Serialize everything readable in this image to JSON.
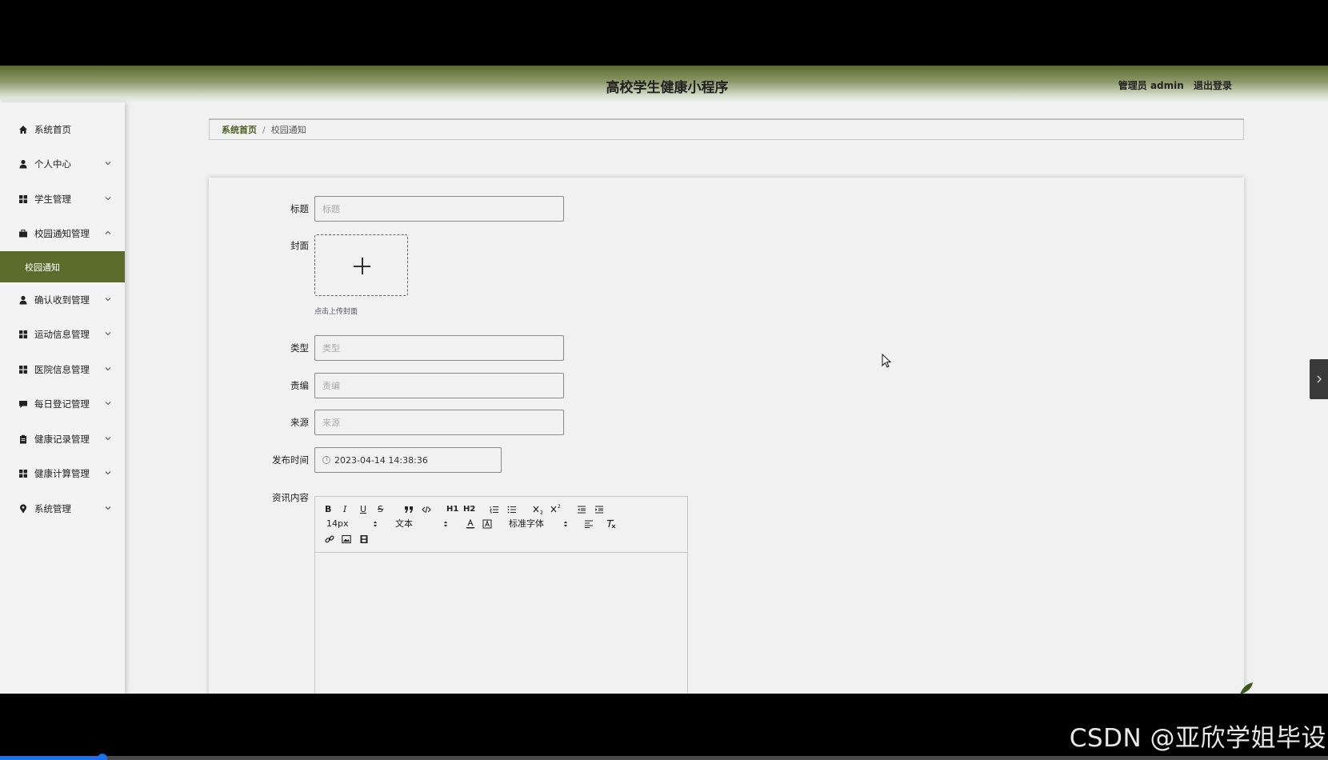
{
  "app": {
    "title": "高校学生健康小程序",
    "user_label": "管理员 admin",
    "logout_label": "退出登录"
  },
  "sidebar": {
    "items": [
      {
        "label": "系统首页",
        "icon": "home-icon",
        "expandable": false
      },
      {
        "label": "个人中心",
        "icon": "user-icon",
        "expandable": true
      },
      {
        "label": "学生管理",
        "icon": "grid-icon",
        "expandable": true
      },
      {
        "label": "校园通知管理",
        "icon": "briefcase-icon",
        "expandable": true,
        "expanded": true
      },
      {
        "label": "确认收到管理",
        "icon": "user-icon",
        "expandable": true
      },
      {
        "label": "运动信息管理",
        "icon": "grid-icon",
        "expandable": true
      },
      {
        "label": "医院信息管理",
        "icon": "grid-icon",
        "expandable": true
      },
      {
        "label": "每日登记管理",
        "icon": "comment-icon",
        "expandable": true
      },
      {
        "label": "健康记录管理",
        "icon": "clipboard-icon",
        "expandable": true
      },
      {
        "label": "健康计算管理",
        "icon": "grid-icon",
        "expandable": true
      },
      {
        "label": "系统管理",
        "icon": "location-icon",
        "expandable": true
      }
    ],
    "active_sub": "校园通知"
  },
  "breadcrumb": {
    "home": "系统首页",
    "separator": "/",
    "current": "校园通知"
  },
  "form": {
    "title_label": "标题",
    "title_placeholder": "标题",
    "cover_label": "封面",
    "cover_hint": "点击上传封面",
    "type_label": "类型",
    "type_placeholder": "类型",
    "editor_label": "责编",
    "editor_placeholder": "责编",
    "source_label": "来源",
    "source_placeholder": "来源",
    "publish_label": "发布时间",
    "publish_value": "2023-04-14 14:38:36",
    "content_label": "资讯内容"
  },
  "rich_editor": {
    "font_size": "14px",
    "block_format": "文本",
    "font_family": "标准字体",
    "h1": "H1",
    "h2": "H2",
    "bold": "B",
    "italic": "I",
    "underline": "U",
    "strike": "S"
  },
  "colors": {
    "accent": "#5a6b2c",
    "sidebar_bg": "#f3f3f3",
    "page_bg": "#f1f1f1"
  },
  "watermark": "CSDN @亚欣学姐毕设",
  "video_progress": 0.077
}
